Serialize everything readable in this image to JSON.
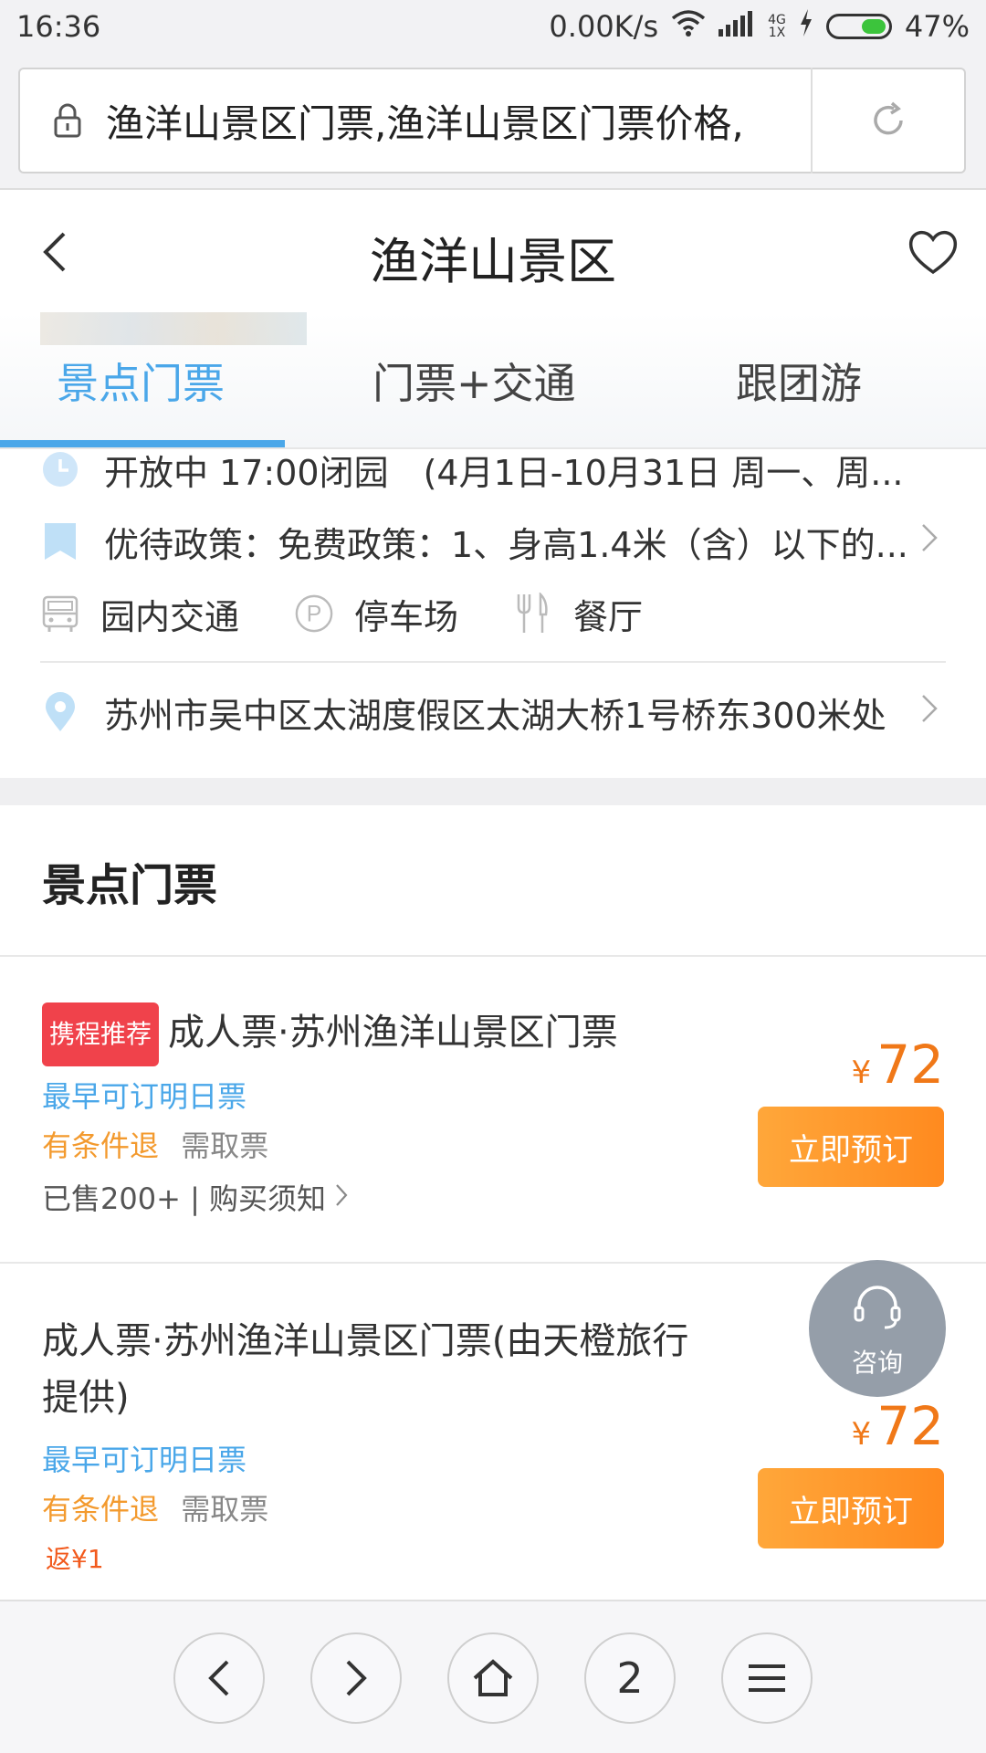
{
  "status_bar": {
    "time": "16:36",
    "network_speed": "0.00K/s",
    "network_type_top": "4G",
    "network_type_bottom": "1X",
    "battery": "47%",
    "battery_level": 0.47
  },
  "browser": {
    "url_text": "渔洋山景区门票,渔洋山景区门票价格,"
  },
  "header": {
    "title": "渔洋山景区"
  },
  "tabs": [
    {
      "label": "景点门票",
      "active": true
    },
    {
      "label": "门票+交通",
      "active": false
    },
    {
      "label": "跟团游",
      "active": false
    }
  ],
  "info": {
    "hours": "开放中 17:00闭园　(4月1日-10月31日 周一、周...",
    "policy": "优待政策：免费政策：1、身高1.4米（含）以下的...",
    "facilities": [
      {
        "icon": "bus-icon",
        "label": "园内交通"
      },
      {
        "icon": "parking-icon",
        "label": "停车场"
      },
      {
        "icon": "restaurant-icon",
        "label": "餐厅"
      }
    ],
    "address": "苏州市吴中区太湖度假区太湖大桥1号桥东300米处"
  },
  "section": {
    "title": "景点门票"
  },
  "tickets": [
    {
      "badge": "携程推荐",
      "title": "成人票·苏州渔洋山景区门票",
      "earliest": "最早可订明日票",
      "refund": "有条件退",
      "pickup": "需取票",
      "sold": "已售200+ | 购买须知",
      "currency": "¥",
      "price": "72",
      "book_label": "立即预订"
    },
    {
      "title": "成人票·苏州渔洋山景区门票(由天橙旅行提供)",
      "earliest": "最早可订明日票",
      "refund": "有条件退",
      "pickup": "需取票",
      "cashback": "返¥1",
      "currency": "¥",
      "price": "72",
      "book_label": "立即预订"
    }
  ],
  "consult": {
    "label": "咨询"
  },
  "bottom_nav": {
    "tab_count": "2"
  },
  "colors": {
    "accent_blue": "#4aa7e9",
    "price_orange": "#f07818",
    "book_button": "#ff8a1f",
    "badge_red": "#f0424b"
  }
}
